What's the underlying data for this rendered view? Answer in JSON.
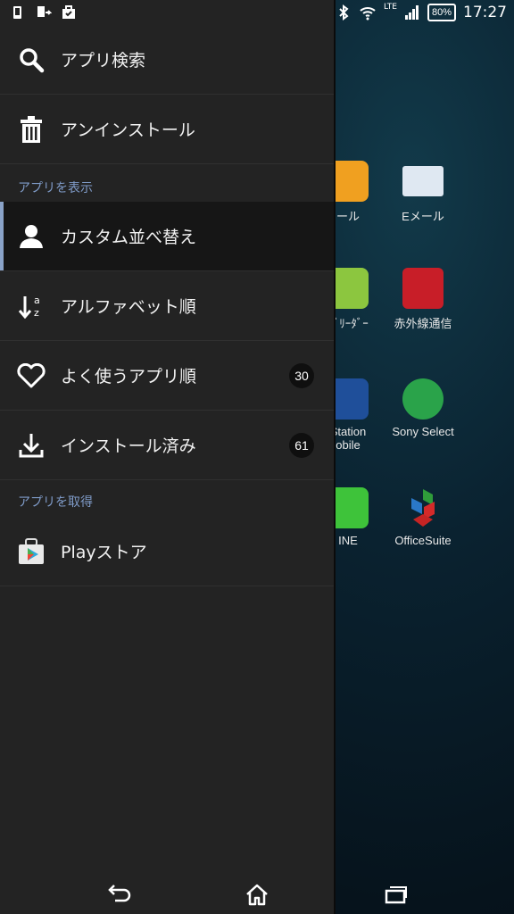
{
  "status_bar": {
    "time": "17:27",
    "battery": "80%",
    "network": "LTE"
  },
  "drawer": {
    "search_label": "アプリ検索",
    "uninstall_label": "アンインストール",
    "section_view": "アプリを表示",
    "items_view": [
      {
        "label": "カスタム並べ替え",
        "icon": "person-icon",
        "selected": true
      },
      {
        "label": "アルファベット順",
        "icon": "sort-az-icon"
      },
      {
        "label": "よく使うアプリ順",
        "icon": "heart-icon",
        "badge": "30"
      },
      {
        "label": "インストール済み",
        "icon": "download-icon",
        "badge": "61"
      }
    ],
    "section_get": "アプリを取得",
    "play_store_label": "Playストア"
  },
  "home_apps": [
    {
      "label": "ール"
    },
    {
      "label": "Eメール"
    },
    {
      "label": "ﾄﾞﾘｰﾀﾞｰ"
    },
    {
      "label": "赤外線通信"
    },
    {
      "label": "Station"
    },
    {
      "label": "obile"
    },
    {
      "label": "Sony Select"
    },
    {
      "label": "INE"
    },
    {
      "label": "OfficeSuite"
    }
  ],
  "colors": {
    "drawer_bg": "#232323",
    "accent": "#8aa3c8",
    "selected_bg": "#161616"
  }
}
